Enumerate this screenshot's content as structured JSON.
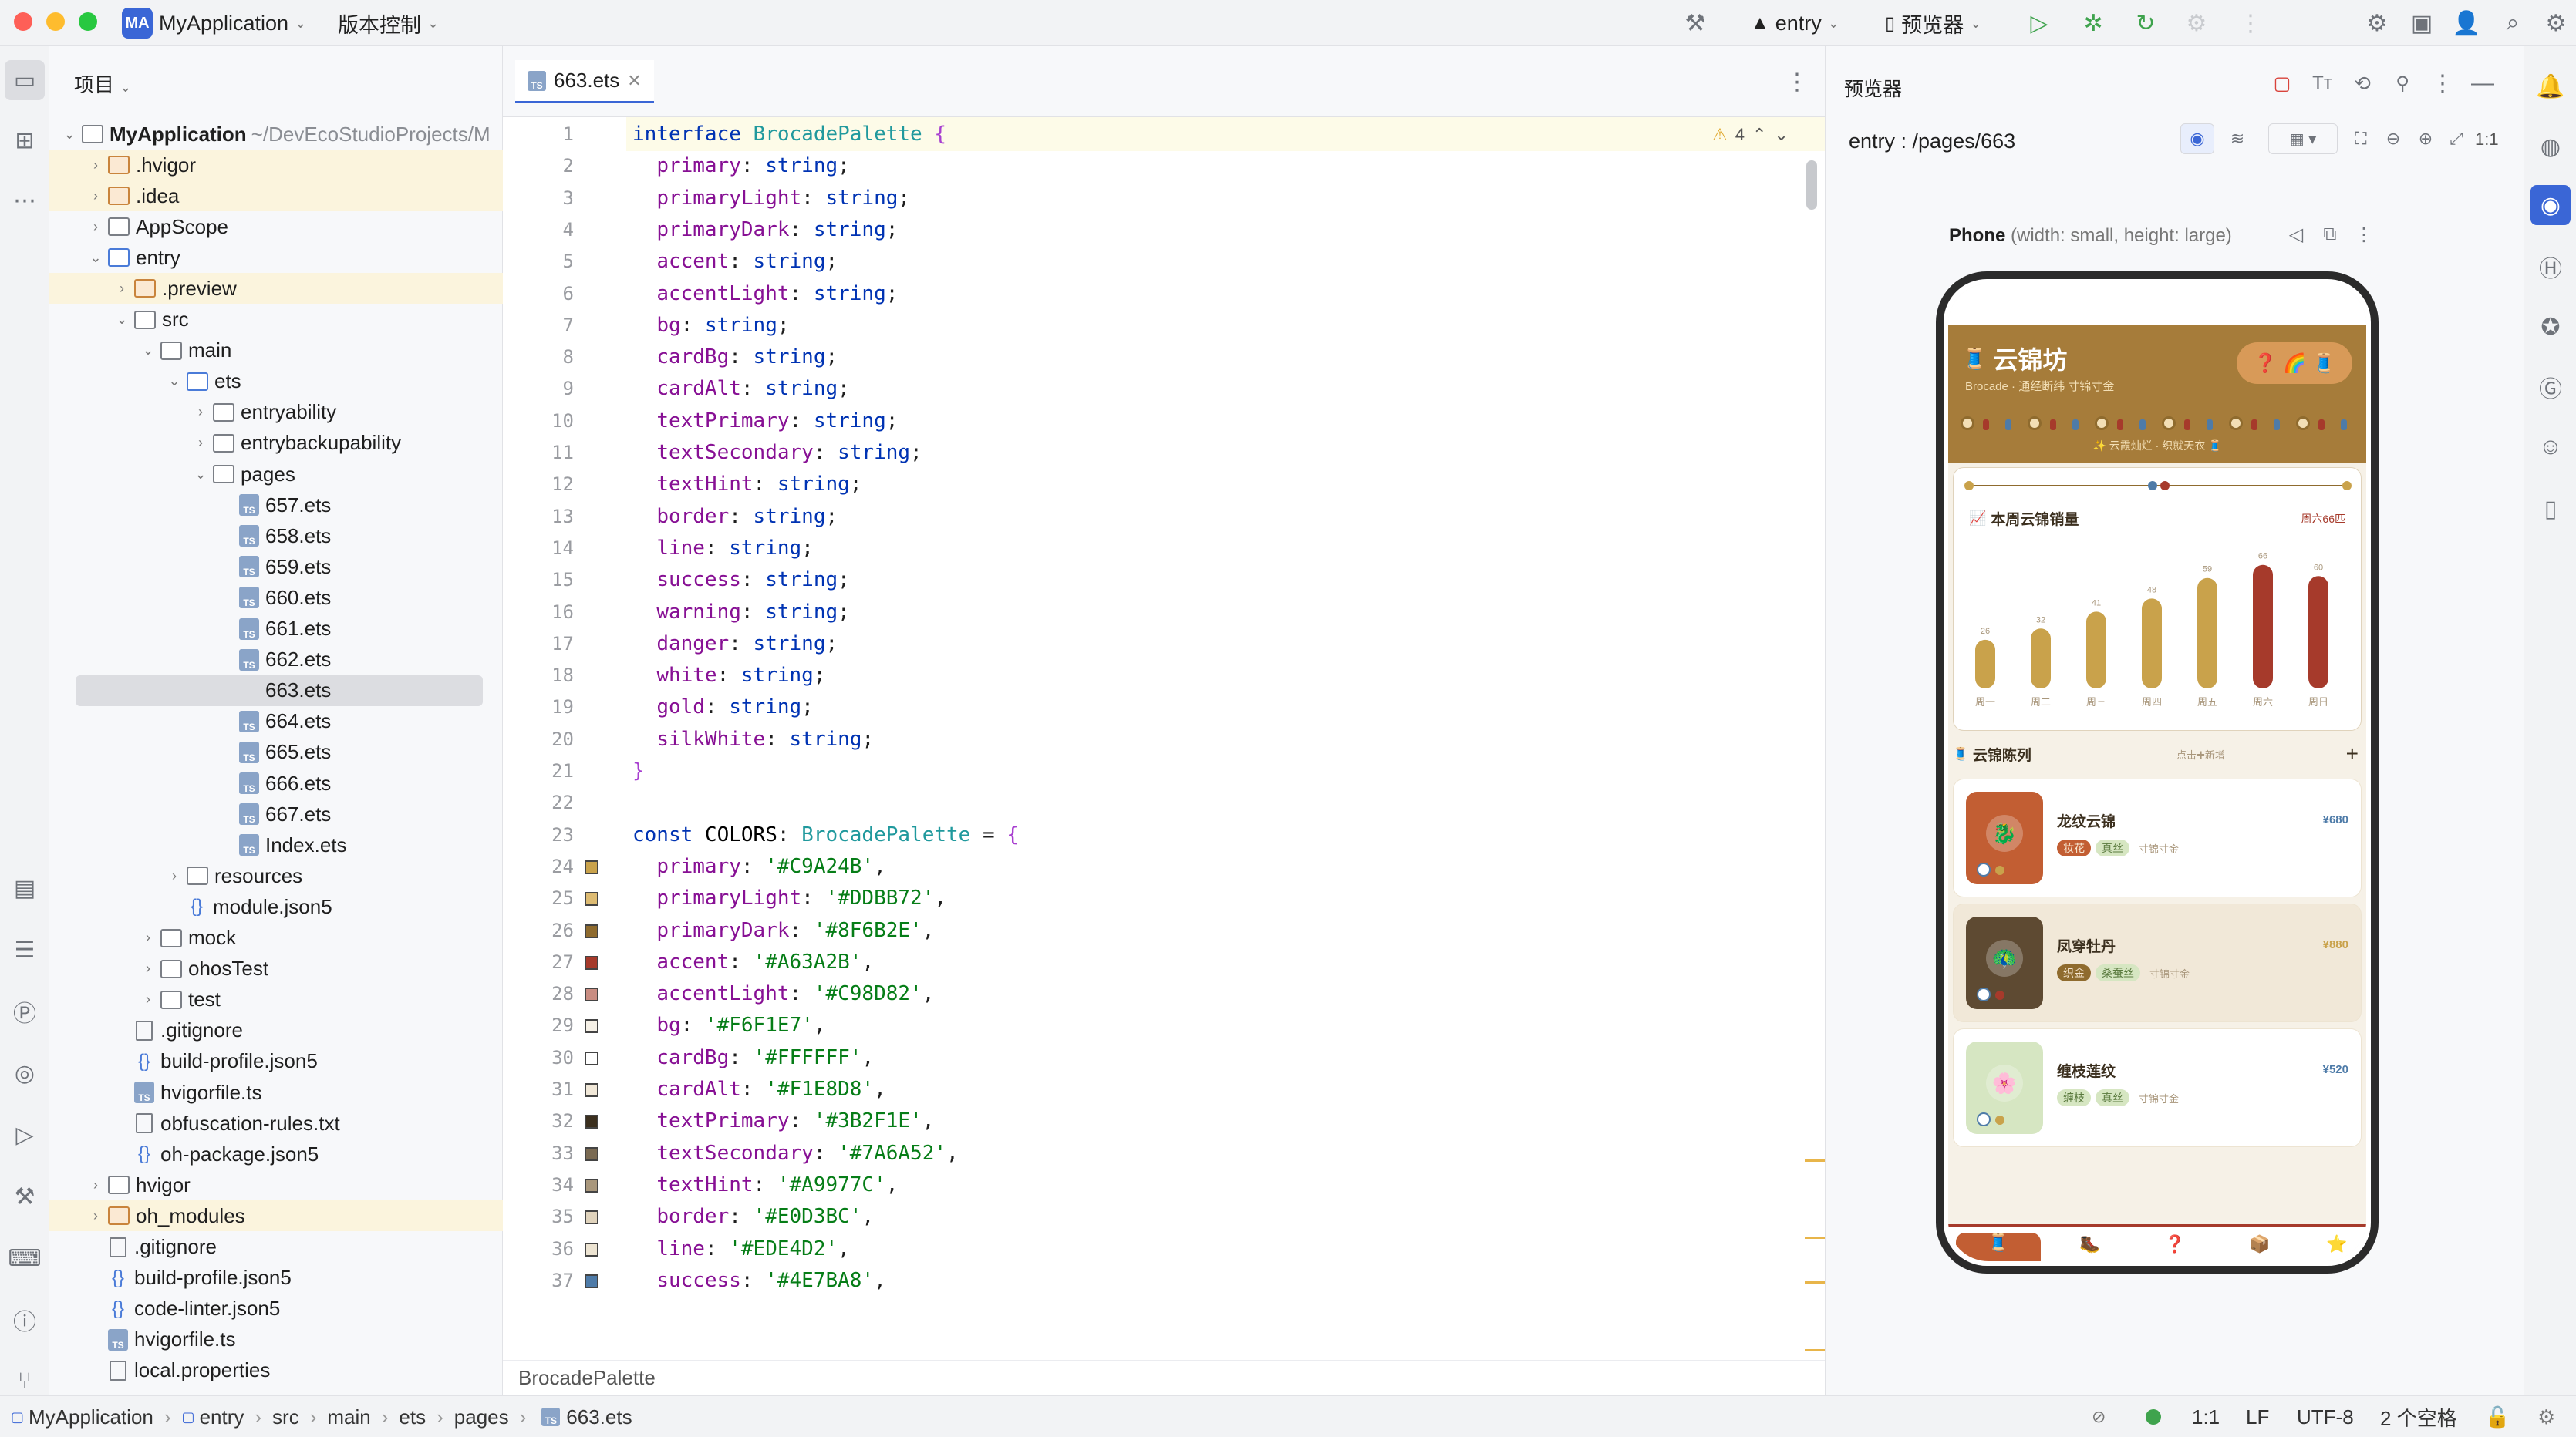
{
  "titlebar": {
    "project_badge": "MA",
    "project": "MyApplication",
    "vcs": "版本控制",
    "run_config": "entry",
    "previewer": "预览器"
  },
  "colors": {
    "accent": "#3a66d6",
    "primary": "#C9A24B",
    "primaryDark": "#8F6B2E",
    "accentRed": "#A63A2B",
    "bg": "#F6F1E7"
  },
  "project_panel": {
    "title": "项目",
    "root_name": "MyApplication",
    "root_path": "~/DevEcoStudioProjects/M",
    "items": [
      ".hvigor",
      ".idea",
      "AppScope",
      "entry",
      ".preview",
      "src",
      "main",
      "ets",
      "entryability",
      "entrybackupability",
      "pages",
      "657.ets",
      "658.ets",
      "659.ets",
      "660.ets",
      "661.ets",
      "662.ets",
      "663.ets",
      "664.ets",
      "665.ets",
      "666.ets",
      "667.ets",
      "Index.ets",
      "resources",
      "module.json5",
      "mock",
      "ohosTest",
      "test",
      ".gitignore",
      "build-profile.json5",
      "hvigorfile.ts",
      "obfuscation-rules.txt",
      "oh-package.json5",
      "hvigor",
      "oh_modules",
      ".gitignore",
      "build-profile.json5",
      "code-linter.json5",
      "hvigorfile.ts",
      "local.properties"
    ]
  },
  "editor": {
    "tab": "663.ets",
    "warnings": "4",
    "breadcrumb": "BrocadePalette",
    "line_numbers": [
      "1",
      "2",
      "3",
      "4",
      "5",
      "6",
      "7",
      "8",
      "9",
      "10",
      "11",
      "12",
      "13",
      "14",
      "15",
      "16",
      "17",
      "18",
      "19",
      "20",
      "21",
      "22",
      "23",
      "24",
      "25",
      "26",
      "27",
      "28",
      "29",
      "30",
      "31",
      "32",
      "33",
      "34",
      "35",
      "36",
      "37"
    ],
    "interface_name": "BrocadePalette",
    "iface_props": [
      "primary",
      "primaryLight",
      "primaryDark",
      "accent",
      "accentLight",
      "bg",
      "cardBg",
      "cardAlt",
      "textPrimary",
      "textSecondary",
      "textHint",
      "border",
      "line",
      "success",
      "warning",
      "danger",
      "white",
      "gold",
      "silkWhite"
    ],
    "const_name": "COLORS",
    "const_props": [
      [
        "primary",
        "'#C9A24B'"
      ],
      [
        "primaryLight",
        "'#DDBB72'"
      ],
      [
        "primaryDark",
        "'#8F6B2E'"
      ],
      [
        "accent",
        "'#A63A2B'"
      ],
      [
        "accentLight",
        "'#C98D82'"
      ],
      [
        "bg",
        "'#F6F1E7'"
      ],
      [
        "cardBg",
        "'#FFFFFF'"
      ],
      [
        "cardAlt",
        "'#F1E8D8'"
      ],
      [
        "textPrimary",
        "'#3B2F1E'"
      ],
      [
        "textSecondary",
        "'#7A6A52'"
      ],
      [
        "textHint",
        "'#A9977C'"
      ],
      [
        "border",
        "'#E0D3BC'"
      ],
      [
        "line",
        "'#EDE4D2'"
      ],
      [
        "success",
        "'#4E7BA8'"
      ]
    ],
    "swatches": [
      "#C9A24B",
      "#DDBB72",
      "#8F6B2E",
      "#A63A2B",
      "#C98D82",
      "#F6F1E7",
      "#FFFFFF",
      "#F1E8D8",
      "#3B2F1E",
      "#7A6A52",
      "#A9977C",
      "#E0D3BC",
      "#EDE4D2",
      "#4E7BA8"
    ]
  },
  "preview": {
    "title": "预览器",
    "route": "entry : /pages/663",
    "device": "Phone",
    "device_desc": "(width: small, height: large)",
    "zoom": "1:1"
  },
  "app": {
    "title": "云锦坊",
    "subtitle": "Brocade · 通经断纬 寸锦寸金",
    "banner": "✨ 云霞灿烂 · 织就天衣 🧵",
    "chart_title": "本周云锦销量",
    "chart_hint": "周六66匹",
    "chart_data": {
      "type": "bar",
      "categories": [
        "周一",
        "周二",
        "周三",
        "周四",
        "周五",
        "周六",
        "周日"
      ],
      "values": [
        26,
        32,
        41,
        48,
        59,
        66,
        60
      ]
    },
    "list_title": "云锦陈列",
    "list_hint": "点击✚新增",
    "products": [
      {
        "name": "龙纹云锦",
        "tags": [
          "妆花",
          "真丝"
        ],
        "hint": "寸锦寸金",
        "price": "¥680",
        "emoji": "🐉",
        "tile": "#C25E33"
      },
      {
        "name": "凤穿牡丹",
        "tags": [
          "织金",
          "桑蚕丝"
        ],
        "hint": "寸锦寸金",
        "price": "¥880",
        "emoji": "🦚",
        "tile": "#5E4A32"
      },
      {
        "name": "缠枝莲纹",
        "tags": [
          "缠枝",
          "真丝"
        ],
        "hint": "寸锦寸金",
        "price": "¥520",
        "emoji": "🌸",
        "tile": "#D6E6C2"
      }
    ]
  },
  "statusbar": {
    "crumbs": [
      "MyApplication",
      "entry",
      "src",
      "main",
      "ets",
      "pages",
      "663.ets"
    ],
    "pos": "1:1",
    "eol": "LF",
    "enc": "UTF-8",
    "indent": "2 个空格"
  }
}
